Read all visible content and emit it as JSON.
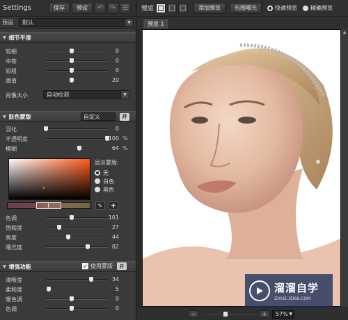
{
  "left": {
    "title": "Settings",
    "save_label": "保存",
    "preset_label": "预设",
    "undo_icon": "undo-icon",
    "redo_icon": "redo-icon",
    "menu_icon": "menu-icon",
    "preset_row": {
      "label": "预设",
      "value": "默认"
    },
    "detail": {
      "title": "细节平滑",
      "sliders": [
        {
          "label": "较细",
          "value": "0",
          "level": 0.42
        },
        {
          "label": "中等",
          "value": "0",
          "level": 0.42
        },
        {
          "label": "较粗",
          "value": "0",
          "level": 0.42
        },
        {
          "label": "阈值",
          "value": "20",
          "level": 0.42
        }
      ],
      "size_label": "肖像大小",
      "size_value": "自动检测"
    },
    "skin": {
      "title": "肤色蒙版",
      "mode": "自定义",
      "toggle": "开",
      "sliders": [
        {
          "label": "羽化",
          "value": "0",
          "unit": "",
          "level": 0.0
        },
        {
          "label": "不透明度",
          "value": "100",
          "unit": "%",
          "level": 1.0
        },
        {
          "label": "模糊",
          "value": "64",
          "unit": "%",
          "level": 0.55
        }
      ],
      "show_mask_label": "显示蒙版:",
      "show_options": [
        {
          "label": "无",
          "selected": true
        },
        {
          "label": "白色",
          "selected": false
        },
        {
          "label": "黑色",
          "selected": false
        }
      ],
      "hsl_sliders": [
        {
          "label": "色调",
          "value": "101",
          "level": 0.42
        },
        {
          "label": "饱和度",
          "value": "27",
          "level": 0.22
        },
        {
          "label": "亮度",
          "value": "44",
          "level": 0.36
        },
        {
          "label": "曝光度",
          "value": "82",
          "level": 0.68
        }
      ]
    },
    "enhance": {
      "title": "增强功能",
      "use_mask_label": "使用蒙版",
      "toggle": "开",
      "sliders": [
        {
          "label": "清晰度",
          "value": "34",
          "level": 0.74
        },
        {
          "label": "柔和度",
          "value": "5",
          "level": 0.05
        },
        {
          "label": "暖色调",
          "value": "0",
          "level": 0.42
        },
        {
          "label": "色调",
          "value": "0",
          "level": 0.42
        }
      ]
    }
  },
  "right": {
    "preview_label": "预览",
    "add_preview": "添加预览",
    "bracket_exposure": "包围曝光",
    "quick_preview": "快速预览",
    "precise_preview": "精确预览",
    "tab": "预览 1",
    "zoom": "57%"
  },
  "watermark": {
    "brand": "溜溜自学",
    "url": "ZIXUE.3D66.COM"
  },
  "colors": {
    "panel": "#3a3a3a",
    "accent_orange": "#ff5a1a",
    "watermark_blue": "#1e3a7a"
  }
}
